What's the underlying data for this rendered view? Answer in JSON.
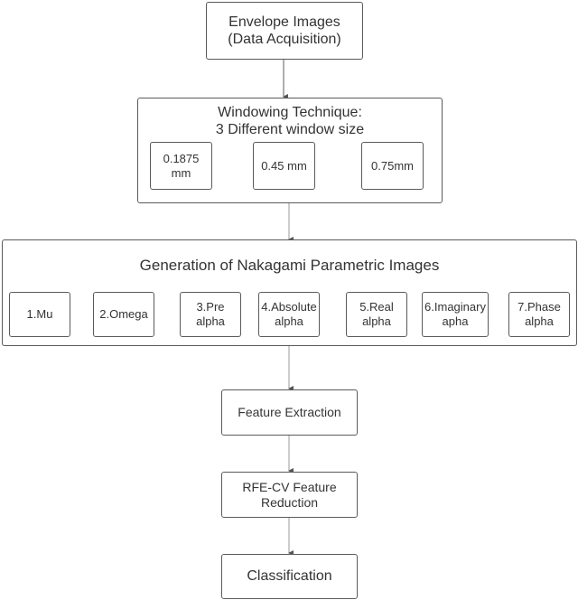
{
  "diagram": {
    "envelope": {
      "label": "Envelope Images\n(Data Acquisition)"
    },
    "windowing": {
      "title": "Windowing Technique:\n3 Different window size",
      "sizes": [
        "0.1875\nmm",
        "0.45 mm",
        "0.75mm"
      ]
    },
    "nakagami": {
      "title": "Generation of Nakagami Parametric Images",
      "params": [
        "1.Mu",
        "2.Omega",
        "3.Pre\nalpha",
        "4.Absolute\nalpha",
        "5.Real\nalpha",
        "6.Imaginary\napha",
        "7.Phase\nalpha"
      ]
    },
    "feature_extraction": {
      "label": "Feature Extraction"
    },
    "feature_reduction": {
      "label": "RFE-CV Feature\nReduction"
    },
    "classification": {
      "label": "Classification"
    }
  }
}
